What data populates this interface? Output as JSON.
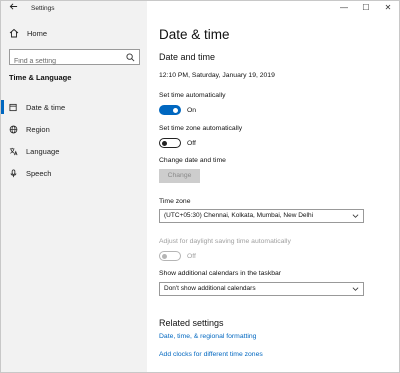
{
  "window": {
    "title": "Settings",
    "back_icon": "arrow-left-icon",
    "controls": [
      "—",
      "☐",
      "✕"
    ]
  },
  "sidebar": {
    "home_label": "Home",
    "search_placeholder": "Find a setting",
    "section_heading": "Time & Language",
    "items": [
      {
        "label": "Date & time",
        "icon": "calendar-clock-icon",
        "active": true
      },
      {
        "label": "Region",
        "icon": "globe-icon",
        "active": false
      },
      {
        "label": "Language",
        "icon": "language-icon",
        "active": false
      },
      {
        "label": "Speech",
        "icon": "microphone-icon",
        "active": false
      }
    ]
  },
  "main": {
    "page_title": "Date & time",
    "sub_title": "Date and time",
    "current_datetime": "12:10 PM, Saturday, January 19, 2019",
    "set_time_auto": {
      "label": "Set time automatically",
      "state": "On"
    },
    "set_tz_auto": {
      "label": "Set time zone automatically",
      "state": "Off"
    },
    "change_label": "Change date and time",
    "change_button": "Change",
    "time_zone": {
      "label": "Time zone",
      "value": "(UTC+05:30) Chennai, Kolkata, Mumbai, New Delhi"
    },
    "dst": {
      "label": "Adjust for daylight saving time automatically",
      "state": "Off"
    },
    "calendars": {
      "label": "Show additional calendars in the taskbar",
      "value": "Don't show additional calendars"
    },
    "related": {
      "title": "Related settings",
      "links": [
        "Date, time, & regional formatting",
        "Add clocks for different time zones"
      ]
    }
  },
  "colors": {
    "accent": "#0067c0",
    "sidebar_bg": "#f2f2f2"
  }
}
